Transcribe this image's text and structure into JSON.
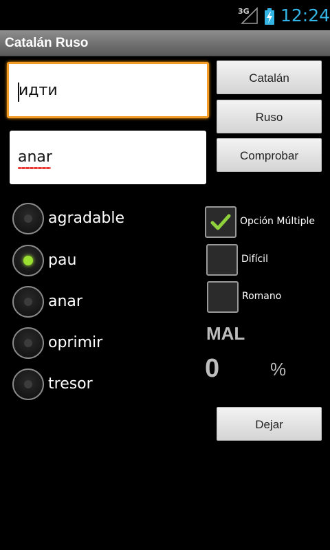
{
  "status_bar": {
    "network_label": "3G",
    "time": "12:24",
    "accent_color": "#33b5e5"
  },
  "app": {
    "title": "Catalán Ruso"
  },
  "fields": {
    "word": {
      "value": "идти"
    },
    "answer": {
      "value": "anar"
    }
  },
  "buttons": {
    "catalan": "Catalán",
    "ruso": "Ruso",
    "comprobar": "Comprobar",
    "dejar": "Dejar"
  },
  "options": [
    {
      "label": "agradable",
      "selected": false
    },
    {
      "label": "pau",
      "selected": true
    },
    {
      "label": "anar",
      "selected": false
    },
    {
      "label": "oprimir",
      "selected": false
    },
    {
      "label": "tresor",
      "selected": false
    }
  ],
  "settings": [
    {
      "label": "Opción Múltiple",
      "checked": true
    },
    {
      "label": "Difícil",
      "checked": false
    },
    {
      "label": "Romano",
      "checked": false
    }
  ],
  "result": {
    "status": "MAL",
    "score": "0",
    "unit": "%"
  },
  "colors": {
    "focus": "#f39c27",
    "radio_on": "#9be030",
    "check": "#8fd13a"
  }
}
